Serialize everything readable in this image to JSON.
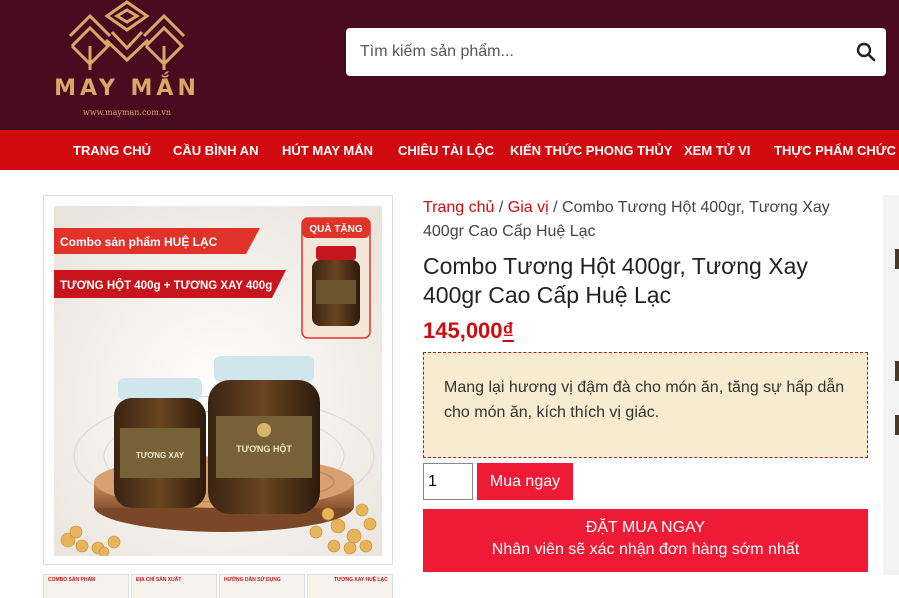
{
  "brand": {
    "name": "MAY MẮN",
    "url": "www.mayman.com.vn",
    "color": "#d9a766"
  },
  "search": {
    "placeholder": "Tìm kiếm sản phẩm...",
    "icon": "search-icon"
  },
  "nav": {
    "items": [
      "TRANG CHỦ",
      "CẦU BÌNH AN",
      "HÚT MAY MẮN",
      "CHIÊU TÀI LỘC",
      "KIẾN THỨC PHONG THỦY",
      "XEM TỬ VI",
      "THỰC PHẨM CHỨC NĂNG"
    ]
  },
  "breadcrumb": {
    "home": "Trang chủ",
    "sep1": " / ",
    "category": "Gia vị",
    "sep2": " / ",
    "current": "Combo Tương Hột 400gr, Tương Xay 400gr Cao Cấp Huệ Lạc"
  },
  "product": {
    "title": "Combo Tương Hột 400gr, Tương Xay 400gr Cao Cấp Huệ Lạc",
    "price": "145,000",
    "currency": "₫",
    "description": "Mang lại hương vị đậm đà cho món ăn, tăng sự hấp dẫn cho món ăn, kích thích vị giác.",
    "quantity": "1",
    "image": {
      "banner_title": "Combo sản phẩm HUỆ LẠC",
      "banner_products": "TƯƠNG HỘT 400g + TƯƠNG XAY 400g",
      "gift_label": "QUÀ TẶNG",
      "jar_left_label": "TƯƠNG XAY",
      "jar_right_label": "TƯƠNG HỘT"
    },
    "thumbnails": [
      {
        "caption": "COMBO SẢN PHẨM"
      },
      {
        "caption": "ĐỊA CHỈ SẢN XUẤT"
      },
      {
        "caption": "HƯỚNG DẪN SỬ DỤNG"
      },
      {
        "caption": "TƯƠNG XAY HUỆ LẠC"
      }
    ]
  },
  "actions": {
    "buy_now": "Mua ngay",
    "order_title": "ĐẶT MUA NGAY",
    "order_subtitle": "Nhân viên sẽ xác nhận đơn hàng sớm nhất"
  },
  "colors": {
    "header_bg": "#4a0a20",
    "nav_bg": "#d10a0f",
    "accent": "#ef1b36",
    "desc_bg": "#f7ebd0"
  }
}
